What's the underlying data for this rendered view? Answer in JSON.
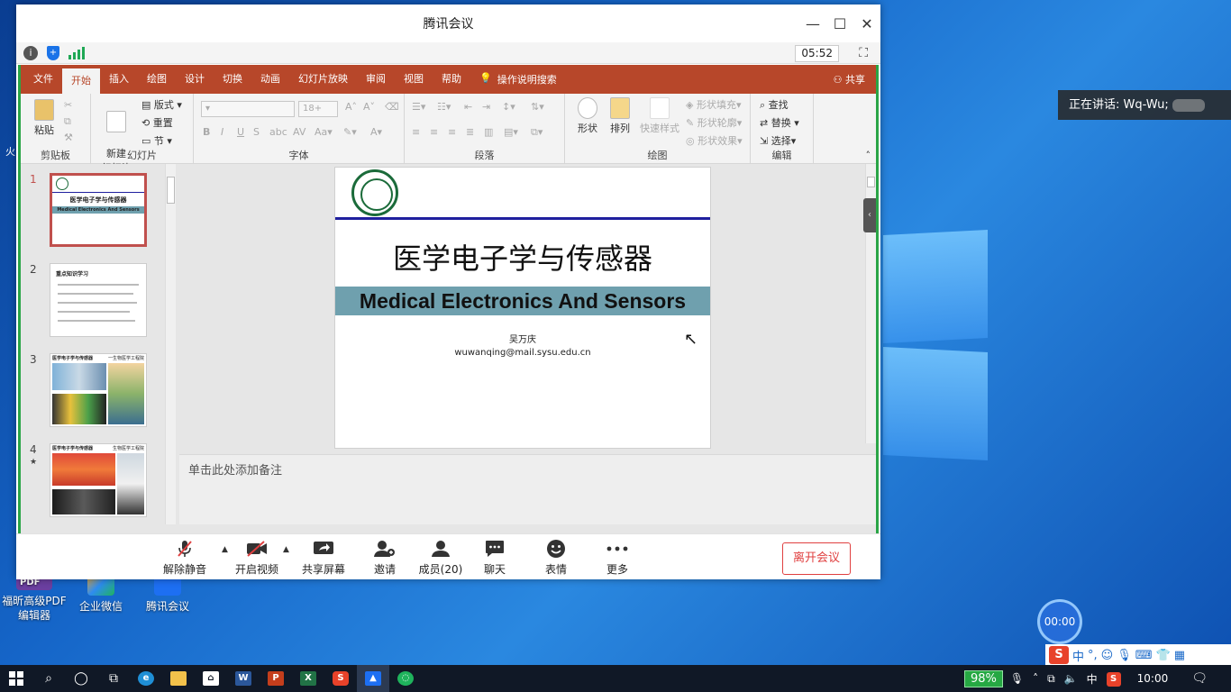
{
  "window": {
    "title": "腾讯会议",
    "minimize": "—",
    "maximize": "☐",
    "close": "✕",
    "elapsed_time": "05:52"
  },
  "ribbon": {
    "tabs": [
      "文件",
      "开始",
      "插入",
      "绘图",
      "设计",
      "切换",
      "动画",
      "幻灯片放映",
      "审阅",
      "视图",
      "帮助"
    ],
    "active_tab": "开始",
    "search_label": "操作说明搜索",
    "share_label": "共享",
    "groups": {
      "clipboard": {
        "label": "剪贴板",
        "paste": "粘贴"
      },
      "slides": {
        "label": "幻灯片",
        "new_slide": "新建\n幻灯片",
        "layout": "版式",
        "reset": "重置",
        "section": "节"
      },
      "font": {
        "label": "字体",
        "size": "18+"
      },
      "paragraph": {
        "label": "段落"
      },
      "drawing": {
        "label": "绘图",
        "shape": "形状",
        "arrange": "排列",
        "quick_styles": "快速样式",
        "fill": "形状填充",
        "outline": "形状轮廓",
        "effects": "形状效果"
      },
      "editing": {
        "label": "编辑",
        "find": "查找",
        "replace": "替换",
        "select": "选择"
      }
    }
  },
  "thumbnails": [
    {
      "num": "1",
      "title": "医学电子学与传感器",
      "subtitle": "Medical Electronics And Sensors"
    },
    {
      "num": "2",
      "title": "重点知识学习"
    },
    {
      "num": "3",
      "title": "医学电子学与传感器",
      "right": "一生物医学工程院"
    },
    {
      "num": "4",
      "title": "医学电子学与传感器",
      "right": "生物医学工程院"
    }
  ],
  "slide": {
    "title_cn": "医学电子学与传感器",
    "title_en": "Medical Electronics And Sensors",
    "author": "吴万庆",
    "email": "wuwanqing@mail.sysu.edu.cn"
  },
  "notes_placeholder": "单击此处添加备注",
  "controls": {
    "unmute": "解除静音",
    "start_video": "开启视频",
    "share_screen": "共享屏幕",
    "invite": "邀请",
    "members": "成员(20)",
    "chat": "聊天",
    "emoji": "表情",
    "more": "更多",
    "leave": "离开会议"
  },
  "speaking": "正在讲话: Wq-Wu;",
  "desktop_icons": [
    {
      "label": "福昕高级PDF\n编辑器",
      "badge": "PDF"
    },
    {
      "label": "企业微信"
    },
    {
      "label": "腾讯会议"
    }
  ],
  "timer_bubble": "00:00",
  "taskbar": {
    "battery": "98%",
    "ime": "中",
    "clock": "10:00"
  },
  "colors": {
    "ppt_red": "#b7472a",
    "share_border": "#2aa546",
    "leave_red": "#e04040",
    "slide_band": "#6fa0ae"
  }
}
